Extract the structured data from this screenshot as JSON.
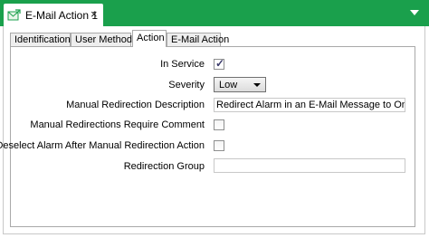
{
  "window": {
    "tab_title": "E-Mail Action 1",
    "tab_icon": "email-action-icon",
    "close_glyph": "×",
    "menu_icon": "chevron-down-icon",
    "accent_color": "#1aa04c"
  },
  "tabs": [
    {
      "label": "Identification",
      "active": false
    },
    {
      "label": "User Methods",
      "active": false
    },
    {
      "label": "Action",
      "active": true
    },
    {
      "label": "E-Mail Action",
      "active": false
    }
  ],
  "form": {
    "in_service": {
      "label": "In Service",
      "checked": true
    },
    "severity": {
      "label": "Severity",
      "value": "Low"
    },
    "manual_redirection_description": {
      "label": "Manual Redirection Description",
      "value": "Redirect Alarm in an E-Mail Message to On-Call Eng"
    },
    "require_comment": {
      "label": "Manual Redirections Require Comment",
      "checked": false
    },
    "deselect_alarm": {
      "label": "Deselect Alarm After Manual Redirection Action",
      "checked": false
    },
    "redirection_group": {
      "label": "Redirection Group",
      "value": ""
    }
  }
}
